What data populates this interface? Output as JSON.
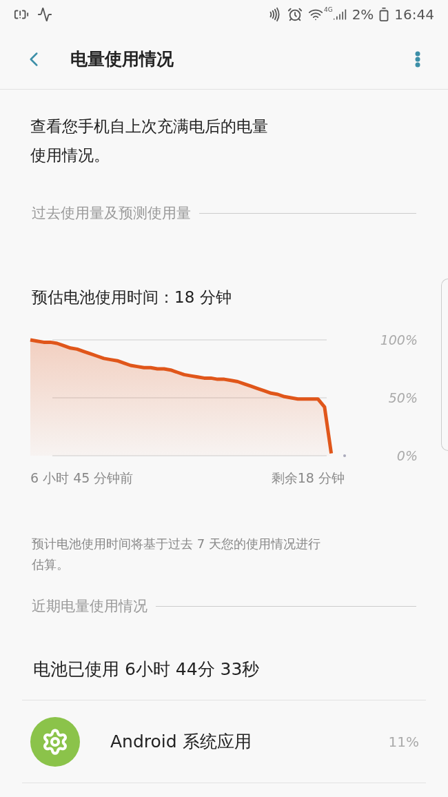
{
  "status_bar": {
    "network": "4G",
    "battery": "2%",
    "time": "16:44"
  },
  "header": {
    "title": "电量使用情况"
  },
  "description": "查看您手机自上次充满电后的电量使用情况。",
  "history_section": {
    "title": "过去使用量及预测使用量",
    "estimate": "预估电池使用时间：18 分钟",
    "time_range": {
      "start": "6 小时 45 分钟前",
      "end": "剩余18 分钟"
    },
    "chart_data": {
      "type": "area",
      "series": [
        {
          "color": "#e0561a",
          "values": [
            100,
            99,
            98,
            98,
            97,
            95,
            93,
            92,
            90,
            88,
            86,
            84,
            83,
            82,
            80,
            78,
            77,
            76,
            76,
            75,
            75,
            74,
            72,
            70,
            69,
            68,
            67,
            67,
            66,
            66,
            65,
            64,
            62,
            60,
            58,
            56,
            54,
            53,
            51,
            50,
            49,
            49,
            49,
            49,
            42,
            2,
            null,
            null
          ]
        }
      ],
      "ylim": [
        0,
        100
      ],
      "yticks": [
        {
          "value": 0,
          "label": "0%"
        },
        {
          "value": 50,
          "label": "50%"
        },
        {
          "value": 100,
          "label": "100%"
        }
      ]
    },
    "footnote": "预计电池使用时间将基于过去 7 天您的使用情况进行估算。"
  },
  "recent_section": {
    "title": "近期电量使用情况",
    "used": "电池已使用 6小时 44分 33秒",
    "apps": [
      {
        "name": "Android 系统应用",
        "percent": "11%"
      }
    ]
  }
}
